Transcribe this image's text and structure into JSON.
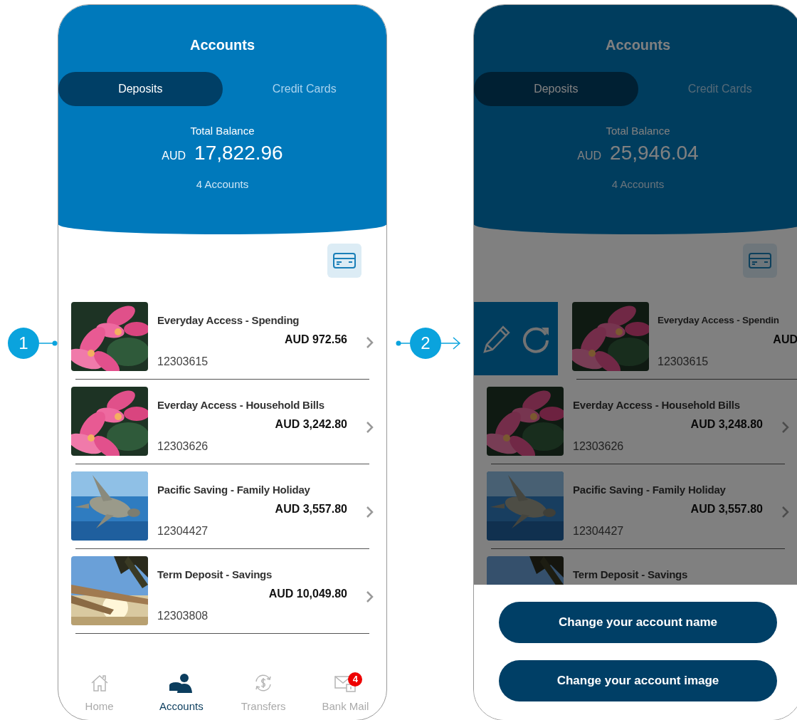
{
  "screens": [
    {
      "title": "Accounts",
      "dimmed": false,
      "tabs": [
        {
          "label": "Deposits",
          "selected": true
        },
        {
          "label": "Credit Cards",
          "selected": false
        }
      ],
      "balance": {
        "label": "Total Balance",
        "currency": "AUD",
        "amount": "17,822.96",
        "count": "4 Accounts"
      },
      "accounts": [
        {
          "name": "Everyday Access - Spending",
          "amount": "AUD 972.56",
          "number": "12303615",
          "swiped": false
        },
        {
          "name": "Everday Access - Household Bills",
          "amount": "AUD 3,242.80",
          "number": "12303626",
          "swiped": false
        },
        {
          "name": "Pacific Saving - Family Holiday",
          "amount": "AUD 3,557.80",
          "number": "12304427",
          "swiped": false
        },
        {
          "name": "Term Deposit - Savings",
          "amount": "AUD 10,049.80",
          "number": "12303808",
          "swiped": false
        }
      ],
      "nav": [
        {
          "label": "Home",
          "selected": false
        },
        {
          "label": "Accounts",
          "selected": true
        },
        {
          "label": "Transfers",
          "selected": false
        },
        {
          "label": "Bank Mail",
          "selected": false,
          "badge": "4"
        }
      ]
    },
    {
      "title": "Accounts",
      "dimmed": true,
      "tabs": [
        {
          "label": "Deposits",
          "selected": true
        },
        {
          "label": "Credit Cards",
          "selected": false
        }
      ],
      "balance": {
        "label": "Total Balance",
        "currency": "AUD",
        "amount": "25,946.04",
        "count": "4 Accounts"
      },
      "accounts": [
        {
          "name": "Everyday Access - Spendin",
          "amount": "AUD",
          "number": "12303615",
          "swiped": true
        },
        {
          "name": "Everday Access - Household Bills",
          "amount": "AUD 3,248.80",
          "number": "12303626",
          "swiped": false
        },
        {
          "name": "Pacific Saving - Family Holiday",
          "amount": "AUD 3,557.80",
          "number": "12304427",
          "swiped": false
        },
        {
          "name": "Term Deposit - Savings",
          "swiped": false
        }
      ],
      "sheet_actions": [
        {
          "label": "Change your account name"
        },
        {
          "label": "Change your account image"
        }
      ]
    }
  ],
  "callouts": [
    {
      "label": "1"
    },
    {
      "label": "2"
    }
  ]
}
